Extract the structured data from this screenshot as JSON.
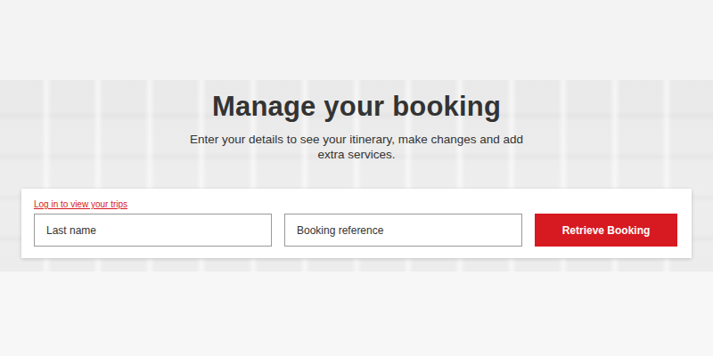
{
  "page": {
    "title": "Manage your booking",
    "subtitle": "Enter your details to see your itinerary, make changes and add extra services."
  },
  "form": {
    "login_link": "Log in to view your trips",
    "fields": [
      {
        "placeholder": "Last name"
      },
      {
        "placeholder": "Booking reference"
      }
    ],
    "submit": "Retrieve Booking"
  }
}
